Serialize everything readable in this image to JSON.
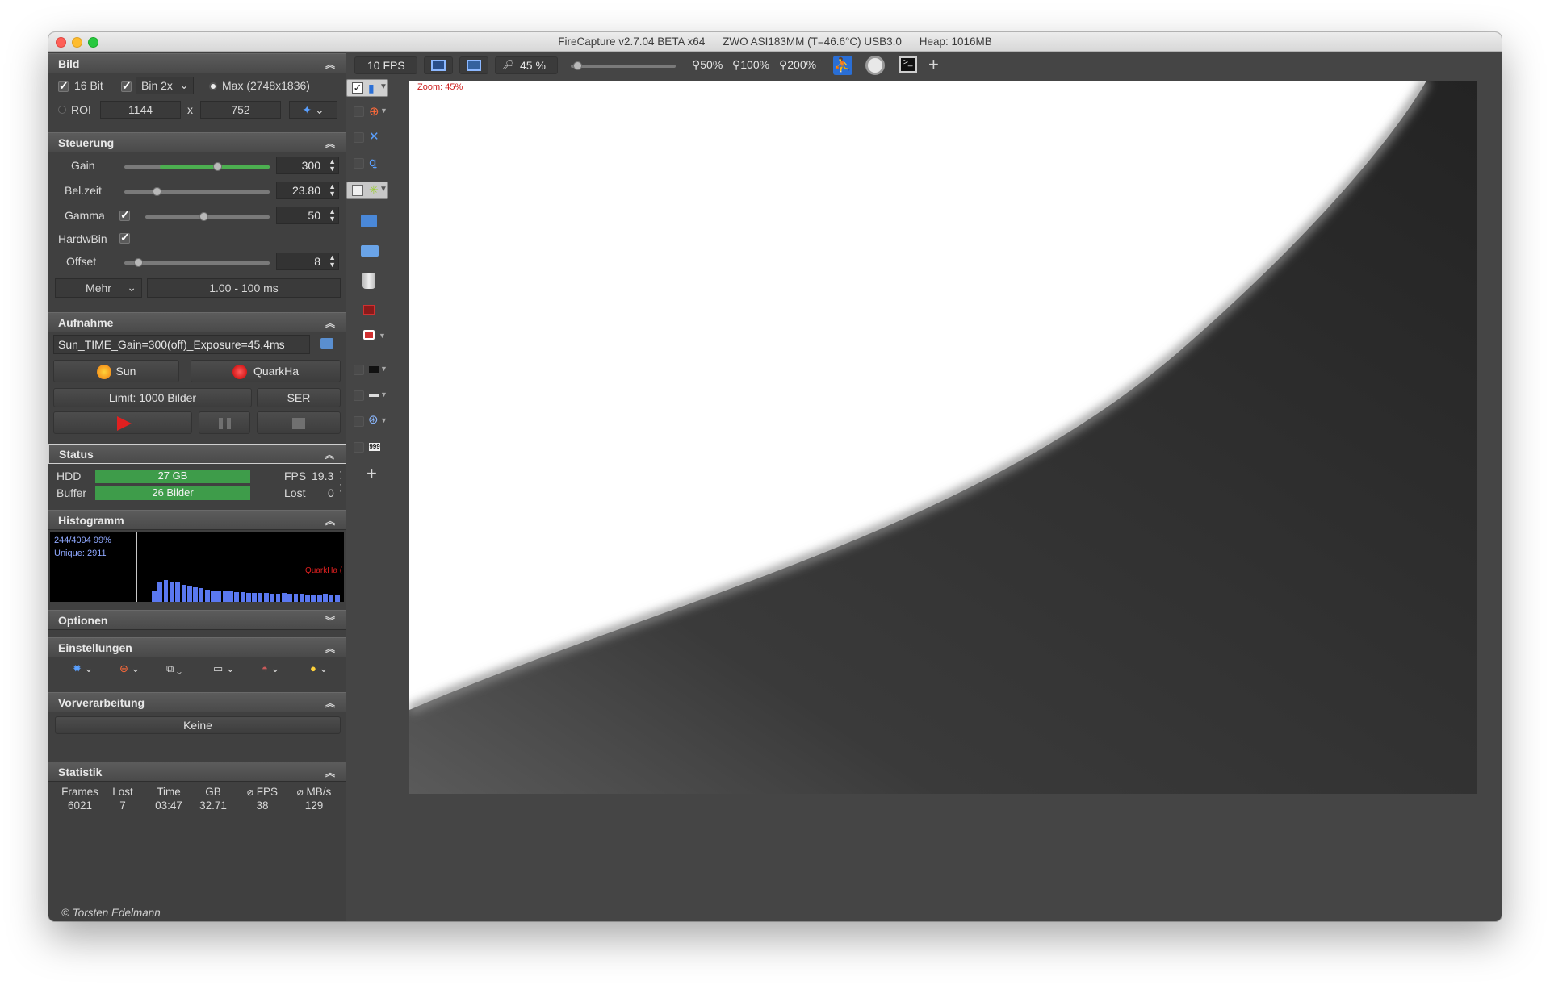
{
  "window": {
    "title_app": "FireCapture v2.7.04 BETA x64",
    "title_camera": "ZWO ASI183MM (T=46.6°C) USB3.0",
    "title_heap": "Heap: 1016MB"
  },
  "bild": {
    "header": "Bild",
    "bit16_label": "16 Bit",
    "bin_label": "Bin 2x",
    "max_label": "Max (2748x1836)",
    "roi_label": "ROI",
    "roi_width": "1144",
    "roi_x": "x",
    "roi_height": "752"
  },
  "steuerung": {
    "header": "Steuerung",
    "gain_label": "Gain",
    "gain_value": "300",
    "belzeit_label": "Bel.zeit",
    "belzeit_value": "23.80",
    "gamma_label": "Gamma",
    "gamma_value": "50",
    "hardwbin_label": "HardwBin",
    "offset_label": "Offset",
    "offset_value": "8",
    "mehr_label": "Mehr",
    "range_label": "1.00 - 100 ms"
  },
  "aufnahme": {
    "header": "Aufnahme",
    "filename": "Sun_TIME_Gain=300(off)_Exposure=45.4ms",
    "profile_label": "Sun",
    "filter_label": "QuarkHa",
    "limit_label": "Limit: 1000 Bilder",
    "format_label": "SER"
  },
  "status": {
    "header": "Status",
    "hdd_label": "HDD",
    "hdd_value": "27 GB",
    "buffer_label": "Buffer",
    "buffer_value": "26  Bilder",
    "fps_label": "FPS",
    "fps_value": "19.3",
    "lost_label": "Lost",
    "lost_value": "0"
  },
  "histogramm": {
    "header": "Histogramm",
    "line1": "244/4094 99%",
    "line2": "Unique: 2911",
    "filter_tag": "QuarkHa (",
    "bars": [
      0.5,
      0.85,
      0.95,
      0.9,
      0.85,
      0.75,
      0.7,
      0.65,
      0.6,
      0.55,
      0.5,
      0.48,
      0.45,
      0.45,
      0.42,
      0.42,
      0.4,
      0.4,
      0.38,
      0.4,
      0.37,
      0.36,
      0.38,
      0.35,
      0.34,
      0.36,
      0.33,
      0.33,
      0.32,
      0.34,
      0.3,
      0.3
    ]
  },
  "optionen": {
    "header": "Optionen"
  },
  "einstellungen": {
    "header": "Einstellungen"
  },
  "vorverarbeitung": {
    "header": "Vorverarbeitung",
    "value": "Keine"
  },
  "statistik": {
    "header": "Statistik",
    "columns": [
      "Frames",
      "Lost",
      "Time",
      "GB",
      "⌀ FPS",
      "⌀ MB/s"
    ],
    "values": [
      "6021",
      "7",
      "03:47",
      "32.71",
      "38",
      "129"
    ]
  },
  "footer": {
    "copyright": "© Torsten Edelmann"
  },
  "toolbar": {
    "fps_label": "10 FPS",
    "zoom_value": "45 %",
    "zoom_50": "50%",
    "zoom_100": "100%",
    "zoom_200": "200%",
    "zoom_slider_level": 0.06
  },
  "preview": {
    "zoom_label": "Zoom: 45%"
  },
  "colors": {
    "accent_green": "#3e9c4a",
    "record_red": "#e02020",
    "histogram_blue": "#5a78f0"
  }
}
